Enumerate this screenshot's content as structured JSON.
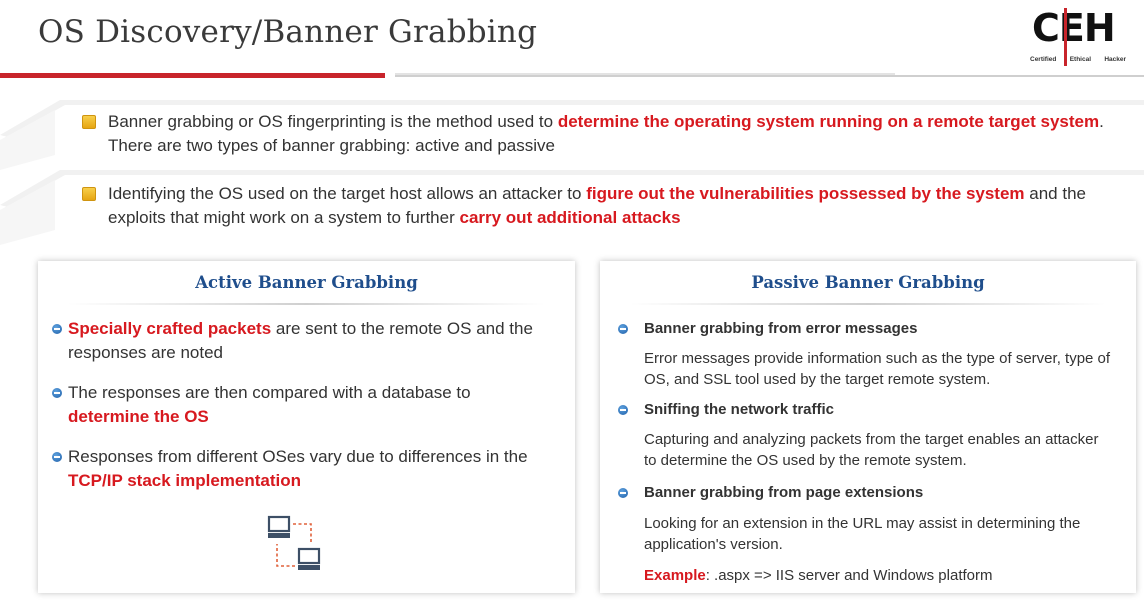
{
  "header": {
    "title": "OS Discovery/Banner Grabbing"
  },
  "logo": {
    "letters": "CEH",
    "sub": [
      "Certified",
      "Ethical",
      "Hacker"
    ]
  },
  "intro": [
    {
      "t1": "Banner grabbing or OS fingerprinting is the method used to ",
      "h1": "determine the operating system running on a remote target system",
      "t2": ". There are two types of banner grabbing: active and passive"
    },
    {
      "t1": "Identifying the OS used on the target host allows an attacker to ",
      "h1": "figure out the vulnerabilities possessed by the system",
      "t2": " and the exploits that might work on a system to further ",
      "h2": "carry out additional attacks"
    }
  ],
  "active": {
    "title": "Active Banner Grabbing",
    "items": [
      {
        "h1": "Specially crafted packets",
        "t1": " are sent to the remote OS and the responses are noted"
      },
      {
        "t1": "The responses are then compared with a database to ",
        "h1": "determine the OS"
      },
      {
        "t1": "Responses from different OSes vary due to differences in the ",
        "h1": "TCP/IP stack implementation"
      }
    ],
    "icon": "network-computers-icon"
  },
  "passive": {
    "title": "Passive Banner Grabbing",
    "items": [
      {
        "heading": "Banner grabbing from error messages",
        "desc": "Error messages provide information such as the type of server, type of OS, and SSL tool used by the target remote system."
      },
      {
        "heading": "Sniffing the network traffic",
        "desc": "Capturing and analyzing packets from the target enables an attacker to determine the OS used by the remote system."
      },
      {
        "heading": "Banner grabbing from page extensions",
        "desc": "Looking for an extension in the URL may assist in determining the application's version."
      }
    ],
    "example": {
      "label": "Example",
      "text": ": .aspx => IIS server and Windows platform"
    }
  },
  "colors": {
    "accent": "#d7191f",
    "title_blue": "#1f4e8c",
    "bullet_yellow": "#f0b820"
  }
}
